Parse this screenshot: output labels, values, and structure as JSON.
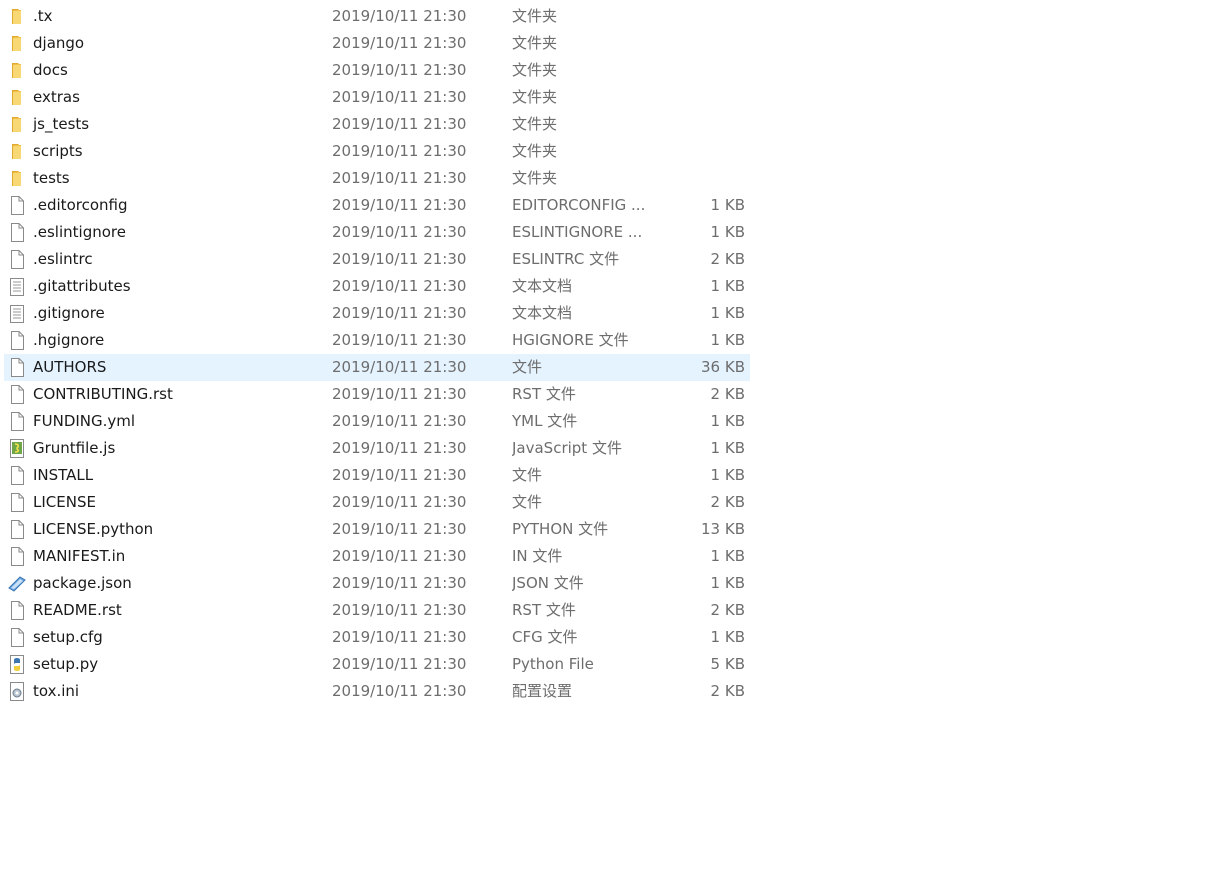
{
  "files": [
    {
      "name": ".tx",
      "date": "2019/10/11 21:30",
      "type": "文件夹",
      "size": "",
      "icon": "folder-icon"
    },
    {
      "name": "django",
      "date": "2019/10/11 21:30",
      "type": "文件夹",
      "size": "",
      "icon": "folder-icon"
    },
    {
      "name": "docs",
      "date": "2019/10/11 21:30",
      "type": "文件夹",
      "size": "",
      "icon": "folder-icon"
    },
    {
      "name": "extras",
      "date": "2019/10/11 21:30",
      "type": "文件夹",
      "size": "",
      "icon": "folder-icon"
    },
    {
      "name": "js_tests",
      "date": "2019/10/11 21:30",
      "type": "文件夹",
      "size": "",
      "icon": "folder-icon"
    },
    {
      "name": "scripts",
      "date": "2019/10/11 21:30",
      "type": "文件夹",
      "size": "",
      "icon": "folder-icon"
    },
    {
      "name": "tests",
      "date": "2019/10/11 21:30",
      "type": "文件夹",
      "size": "",
      "icon": "folder-icon"
    },
    {
      "name": ".editorconfig",
      "date": "2019/10/11 21:30",
      "type": "EDITORCONFIG ...",
      "size": "1 KB",
      "icon": "file-icon"
    },
    {
      "name": ".eslintignore",
      "date": "2019/10/11 21:30",
      "type": "ESLINTIGNORE ...",
      "size": "1 KB",
      "icon": "file-icon"
    },
    {
      "name": ".eslintrc",
      "date": "2019/10/11 21:30",
      "type": "ESLINTRC 文件",
      "size": "2 KB",
      "icon": "file-icon"
    },
    {
      "name": ".gitattributes",
      "date": "2019/10/11 21:30",
      "type": "文本文档",
      "size": "1 KB",
      "icon": "text-file-icon"
    },
    {
      "name": ".gitignore",
      "date": "2019/10/11 21:30",
      "type": "文本文档",
      "size": "1 KB",
      "icon": "text-file-icon"
    },
    {
      "name": ".hgignore",
      "date": "2019/10/11 21:30",
      "type": "HGIGNORE 文件",
      "size": "1 KB",
      "icon": "file-icon"
    },
    {
      "name": "AUTHORS",
      "date": "2019/10/11 21:30",
      "type": "文件",
      "size": "36 KB",
      "icon": "file-icon",
      "selected": true
    },
    {
      "name": "CONTRIBUTING.rst",
      "date": "2019/10/11 21:30",
      "type": "RST 文件",
      "size": "2 KB",
      "icon": "file-icon"
    },
    {
      "name": "FUNDING.yml",
      "date": "2019/10/11 21:30",
      "type": "YML 文件",
      "size": "1 KB",
      "icon": "file-icon"
    },
    {
      "name": "Gruntfile.js",
      "date": "2019/10/11 21:30",
      "type": "JavaScript 文件",
      "size": "1 KB",
      "icon": "javascript-file-icon"
    },
    {
      "name": "INSTALL",
      "date": "2019/10/11 21:30",
      "type": "文件",
      "size": "1 KB",
      "icon": "file-icon"
    },
    {
      "name": "LICENSE",
      "date": "2019/10/11 21:30",
      "type": "文件",
      "size": "2 KB",
      "icon": "file-icon"
    },
    {
      "name": "LICENSE.python",
      "date": "2019/10/11 21:30",
      "type": "PYTHON 文件",
      "size": "13 KB",
      "icon": "file-icon"
    },
    {
      "name": "MANIFEST.in",
      "date": "2019/10/11 21:30",
      "type": "IN 文件",
      "size": "1 KB",
      "icon": "file-icon"
    },
    {
      "name": "package.json",
      "date": "2019/10/11 21:30",
      "type": "JSON 文件",
      "size": "1 KB",
      "icon": "json-file-icon"
    },
    {
      "name": "README.rst",
      "date": "2019/10/11 21:30",
      "type": "RST 文件",
      "size": "2 KB",
      "icon": "file-icon"
    },
    {
      "name": "setup.cfg",
      "date": "2019/10/11 21:30",
      "type": "CFG 文件",
      "size": "1 KB",
      "icon": "file-icon"
    },
    {
      "name": "setup.py",
      "date": "2019/10/11 21:30",
      "type": "Python File",
      "size": "5 KB",
      "icon": "python-file-icon"
    },
    {
      "name": "tox.ini",
      "date": "2019/10/11 21:30",
      "type": "配置设置",
      "size": "2 KB",
      "icon": "settings-file-icon"
    }
  ],
  "colors": {
    "selection": "#e5f3ff",
    "folder": "#f4c84c",
    "secondary_text": "#6d6d6d"
  }
}
